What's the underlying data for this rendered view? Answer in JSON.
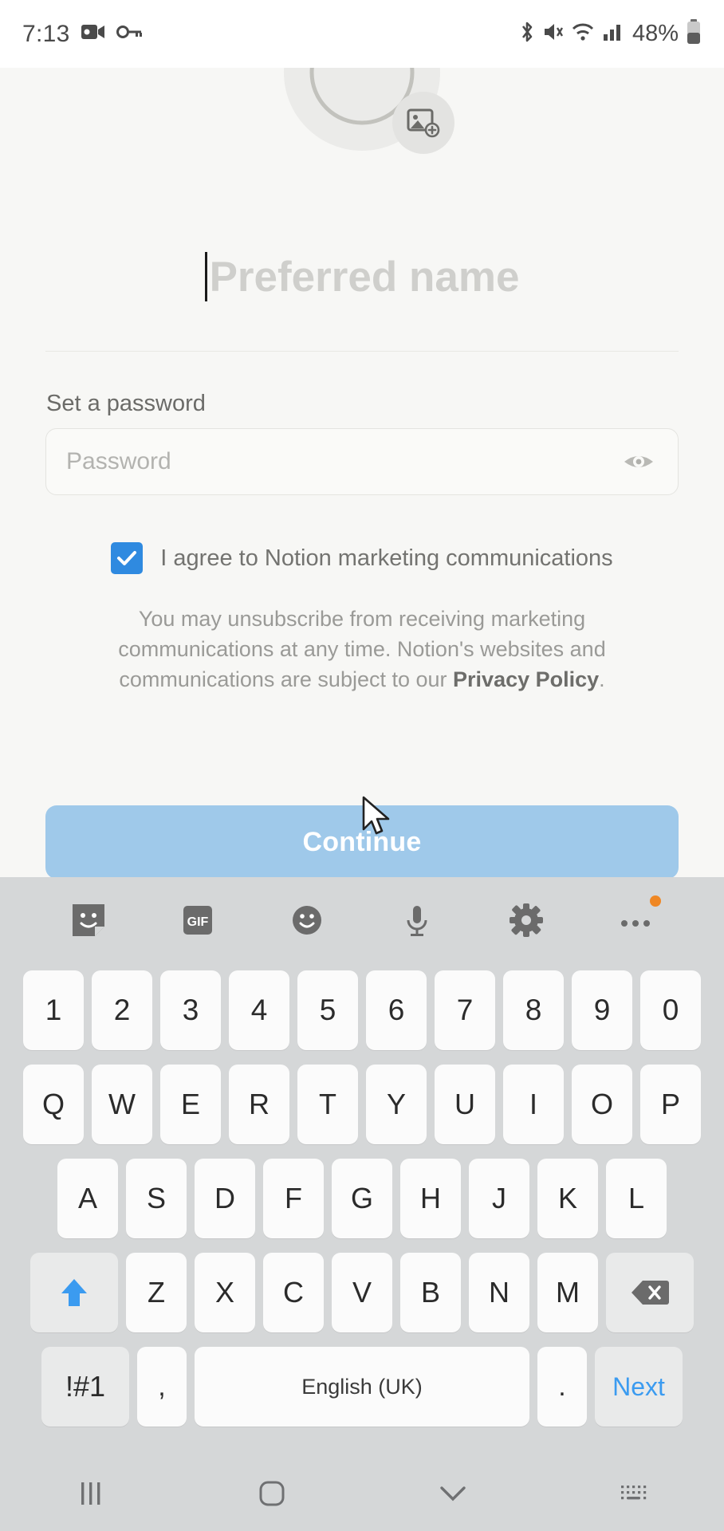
{
  "status_bar": {
    "time": "7:13",
    "battery_percent": "48%",
    "icons": [
      "video-camera-icon",
      "key-icon",
      "bluetooth-icon",
      "mute-icon",
      "wifi-icon",
      "signal-icon",
      "battery-icon"
    ]
  },
  "app": {
    "avatar": {
      "icon": "avatar-placeholder-face-icon",
      "badge_icon": "add-photo-icon"
    },
    "name_input": {
      "placeholder": "Preferred name",
      "value": ""
    },
    "password_section": {
      "label": "Set a password",
      "placeholder": "Password",
      "value": "",
      "reveal_icon": "eye-icon"
    },
    "marketing_consent": {
      "checked": true,
      "label": "I agree to Notion marketing communications",
      "accent_color": "#2f8ae0"
    },
    "disclaimer": {
      "text_before": "You may unsubscribe from receiving marketing communications at any time. Notion's websites and communications are subject to our ",
      "link": "Privacy Policy",
      "text_after": "."
    },
    "continue_button": {
      "label": "Continue",
      "color": "#9fc9ea"
    }
  },
  "keyboard": {
    "toolbar": [
      {
        "name": "sticker-icon"
      },
      {
        "name": "gif-icon",
        "label": "GIF"
      },
      {
        "name": "emoji-icon"
      },
      {
        "name": "microphone-icon"
      },
      {
        "name": "settings-gear-icon"
      },
      {
        "name": "more-options-icon",
        "badge": true
      }
    ],
    "row_numbers": [
      "1",
      "2",
      "3",
      "4",
      "5",
      "6",
      "7",
      "8",
      "9",
      "0"
    ],
    "row_top": [
      "Q",
      "W",
      "E",
      "R",
      "T",
      "Y",
      "U",
      "I",
      "O",
      "P"
    ],
    "row_home": [
      "A",
      "S",
      "D",
      "F",
      "G",
      "H",
      "J",
      "K",
      "L"
    ],
    "row_bottom": [
      "Z",
      "X",
      "C",
      "V",
      "B",
      "N",
      "M"
    ],
    "shift_key": "shift-icon",
    "backspace_key": "backspace-icon",
    "row_last": {
      "symbols": "!#1",
      "comma": ",",
      "space": "English (UK)",
      "period": ".",
      "action": "Next"
    }
  },
  "nav_bar": {
    "recents": "recents-icon",
    "home": "home-icon",
    "hide_keyboard": "chevron-down-icon",
    "keyboard_switch": "keyboard-switch-icon"
  }
}
